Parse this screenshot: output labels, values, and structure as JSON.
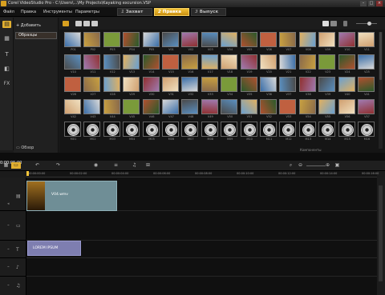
{
  "window": {
    "title": "Corel VideoStudio Pro - C:\\Users\\...\\My Projects\\Kayaking excursion.VSP"
  },
  "menu": [
    "Файл",
    "Правка",
    "Инструменты",
    "Параметры"
  ],
  "steps": [
    {
      "num": "1",
      "label": "Захват"
    },
    {
      "num": "2",
      "label": "Правка"
    },
    {
      "num": "3",
      "label": "Выпуск"
    }
  ],
  "library": {
    "add_label": "Добавить",
    "folder_label": "Образцы",
    "browse_label": "Обзор"
  },
  "thumbnails": {
    "rows": [
      [
        "P01",
        "P02",
        "P03",
        "P04",
        "P05",
        "V01",
        "V02",
        "V03",
        "V04",
        "V05",
        "V06",
        "V07",
        "V08",
        "V09",
        "V10",
        "V11"
      ],
      [
        "V10",
        "V11",
        "V12",
        "V13",
        "V14",
        "V15",
        "V16",
        "V17",
        "V18",
        "V19",
        "V20",
        "V21",
        "V22",
        "V23",
        "V24",
        "V25"
      ],
      [
        "V26",
        "V27",
        "V28",
        "V29",
        "V30",
        "V31",
        "V32",
        "V33",
        "V34",
        "V35",
        "V36",
        "V37",
        "V38",
        "V39",
        "V40",
        "V41"
      ],
      [
        "V42",
        "V43",
        "V44",
        "V45",
        "V46",
        "V47",
        "V48",
        "V49",
        "V50",
        "V51",
        "V52",
        "V53",
        "V54",
        "V55",
        "V56",
        "V57"
      ],
      [
        "M01",
        "M02",
        "M03",
        "M04",
        "M05",
        "M06",
        "M07",
        "M08",
        "M09",
        "M10",
        "M11",
        "M12",
        "M13",
        "M14",
        "M15",
        "M16"
      ]
    ],
    "caption": "Компоненты"
  },
  "timeline": {
    "timecode": "0:00:05:00",
    "ruler": [
      "00:00:00:00",
      "00:00:02:00",
      "00:00:04:00",
      "00:00:06:00",
      "00:00:08:00",
      "00:00:10:00",
      "00:00:12:00",
      "00:00:14:00",
      "00:00:16:00"
    ],
    "video_clip": "V04.wmv",
    "title_clip": "LOREM IPSUM"
  },
  "colors": {
    "accent": "#f2c23a",
    "video_clip": "#6f8e96",
    "title_clip": "#7e7eb0"
  }
}
